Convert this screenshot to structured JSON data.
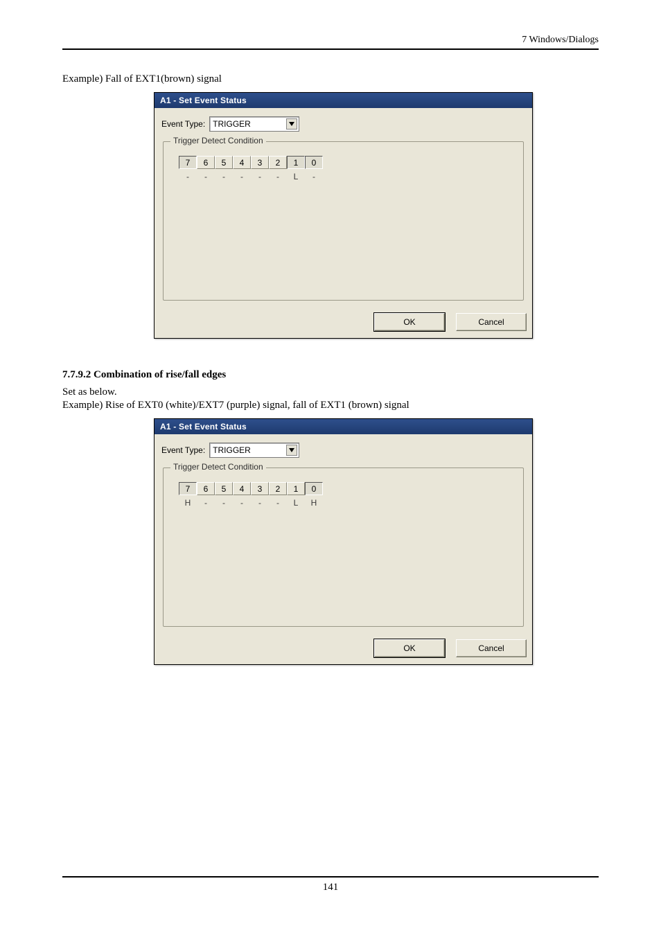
{
  "running_head": "7  Windows/Dialogs",
  "caption1": "Example) Fall of EXT1(brown) signal",
  "section_heading": "7.7.9.2 Combination of rise/fall edges",
  "body_line1": "Set as below.",
  "body_line2": "Example) Rise of EXT0 (white)/EXT7 (purple) signal, fall of EXT1 (brown) signal",
  "page_number": "141",
  "dialog1": {
    "title": "A1 - Set Event Status",
    "event_type_label": "Event Type:",
    "event_type_value": "TRIGGER",
    "group_label": "Trigger Detect Condition",
    "bits": [
      "7",
      "6",
      "5",
      "4",
      "3",
      "2",
      "1",
      "0"
    ],
    "selected": [
      true,
      false,
      false,
      false,
      false,
      false,
      true,
      true
    ],
    "values": [
      "-",
      "-",
      "-",
      "-",
      "-",
      "-",
      "L",
      "-"
    ],
    "ok_label": "OK",
    "cancel_label": "Cancel"
  },
  "dialog2": {
    "title": "A1 - Set Event Status",
    "event_type_label": "Event Type:",
    "event_type_value": "TRIGGER",
    "group_label": "Trigger Detect Condition",
    "bits": [
      "7",
      "6",
      "5",
      "4",
      "3",
      "2",
      "1",
      "0"
    ],
    "selected": [
      true,
      false,
      false,
      false,
      false,
      false,
      false,
      true
    ],
    "values": [
      "H",
      "-",
      "-",
      "-",
      "-",
      "-",
      "L",
      "H"
    ],
    "ok_label": "OK",
    "cancel_label": "Cancel"
  }
}
